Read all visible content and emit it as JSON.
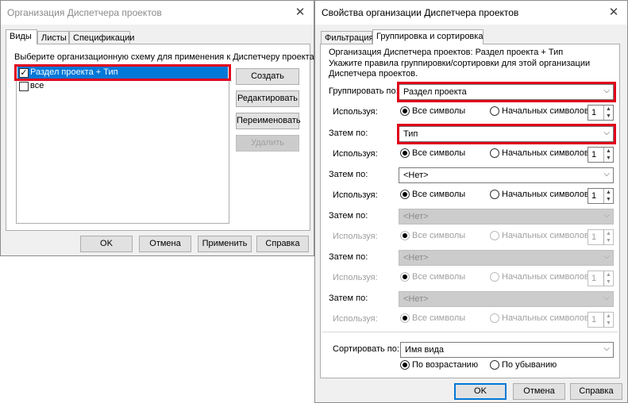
{
  "left_dialog": {
    "title": "Организация Диспетчера проектов",
    "close_icon": "close-icon",
    "tabs": [
      "Виды",
      "Листы",
      "Спецификации"
    ],
    "instruction": "Выберите организационную схему для применения к Диспетчеру проекта.",
    "items": [
      {
        "label": "Раздел проекта + Тип",
        "checked": true,
        "selected": true
      },
      {
        "label": "все",
        "checked": false,
        "selected": false
      }
    ],
    "side_buttons": [
      "Создать",
      "Редактировать",
      "Переименовать",
      "Удалить"
    ],
    "footer_buttons": [
      "OK",
      "Отмена",
      "Применить",
      "Справка"
    ]
  },
  "right_dialog": {
    "title": "Свойства организации Диспетчера проектов",
    "close_icon": "close-icon",
    "tabs": [
      "Фильтрация",
      "Группировка и сортировка"
    ],
    "info_line1": "Организация Диспетчера проектов: Раздел проекта + Тип",
    "info_line2": "Укажите правила группировки/сортировки для этой организации",
    "info_line3": "Диспетчера проектов.",
    "group_label": "Группировать по:",
    "then_label": "Затем по:",
    "using_label": "Используя:",
    "all_chars": "Все символы",
    "start_chars": "Начальных символов",
    "levels": [
      {
        "value": "Раздел проекта",
        "enabled": true,
        "mode": "all",
        "count": "1"
      },
      {
        "value": "Тип",
        "enabled": true,
        "mode": "all",
        "count": "1"
      },
      {
        "value": "<Нет>",
        "enabled": true,
        "mode": "all",
        "count": "1"
      },
      {
        "value": "<Нет>",
        "enabled": false,
        "mode": "all",
        "count": "1"
      },
      {
        "value": "<Нет>",
        "enabled": false,
        "mode": "all",
        "count": "1"
      },
      {
        "value": "<Нет>",
        "enabled": false,
        "mode": "all",
        "count": "1"
      }
    ],
    "sort_label": "Сортировать по:",
    "sort_value": "Имя вида",
    "ascending": "По возрастанию",
    "descending": "По убыванию",
    "sort_order": "ascending",
    "footer_buttons": [
      "OK",
      "Отмена",
      "Справка"
    ]
  },
  "colors": {
    "highlight": "#e0001b",
    "selection": "#0078d7",
    "window_bg": "#f0f0f0"
  }
}
